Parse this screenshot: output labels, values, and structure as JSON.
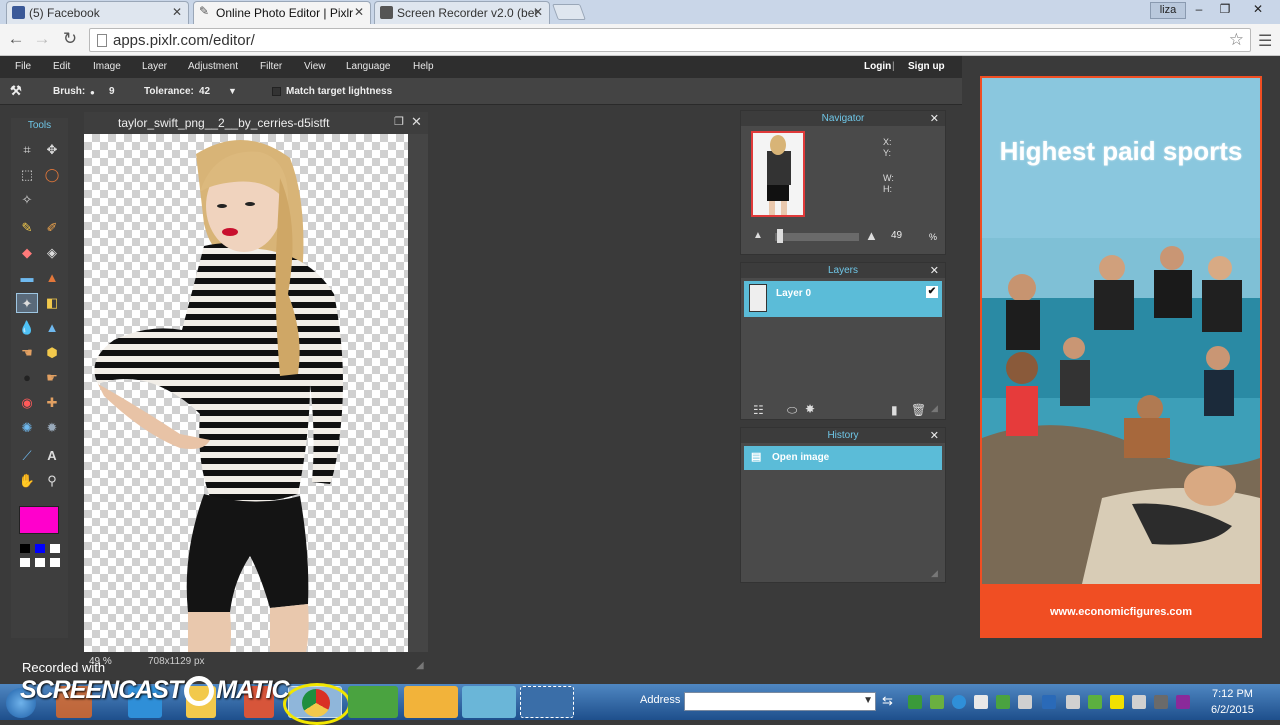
{
  "browser": {
    "tabs": [
      {
        "title": "(5) Facebook",
        "icon": "facebook-icon",
        "active": false
      },
      {
        "title": "Online Photo Editor | Pixlr",
        "icon": "pencil-icon",
        "active": true
      },
      {
        "title": "Screen Recorder v2.0 (bet",
        "icon": "screencast-icon",
        "active": false
      }
    ],
    "user": "liza",
    "url": "apps.pixlr.com/editor/"
  },
  "menu": {
    "items": [
      "File",
      "Edit",
      "Image",
      "Layer",
      "Adjustment",
      "Filter",
      "View",
      "Language",
      "Help"
    ],
    "login": "Login",
    "separator": "|",
    "signup": "Sign up"
  },
  "options": {
    "brush_label": "Brush:",
    "brush_size": "9",
    "tolerance_label": "Tolerance:",
    "tolerance_value": "42",
    "match_label": "Match target lightness"
  },
  "tools": {
    "title": "Tools",
    "fg_color": "#ff00cc"
  },
  "document": {
    "title": "taylor_swift_png__2__by_cerries-d5istft",
    "zoom": "49",
    "zoom_unit": "%",
    "dimensions": "708x1129 px"
  },
  "navigator": {
    "title": "Navigator",
    "x_label": "X:",
    "y_label": "Y:",
    "w_label": "W:",
    "h_label": "H:",
    "zoom": "49",
    "zoom_unit": "%"
  },
  "layers": {
    "title": "Layers",
    "items": [
      {
        "name": "Layer 0",
        "visible": true
      }
    ]
  },
  "history": {
    "title": "History",
    "items": [
      "Open image"
    ]
  },
  "ad": {
    "headline": "Highest paid sports",
    "url": "www.economicfigures.com"
  },
  "watermark": {
    "recorded": "Recorded with",
    "brand": "SCREENCAST-O-MATIC"
  },
  "taskbar": {
    "address_label": "Address",
    "time": "7:12 PM",
    "date": "6/2/2015"
  }
}
